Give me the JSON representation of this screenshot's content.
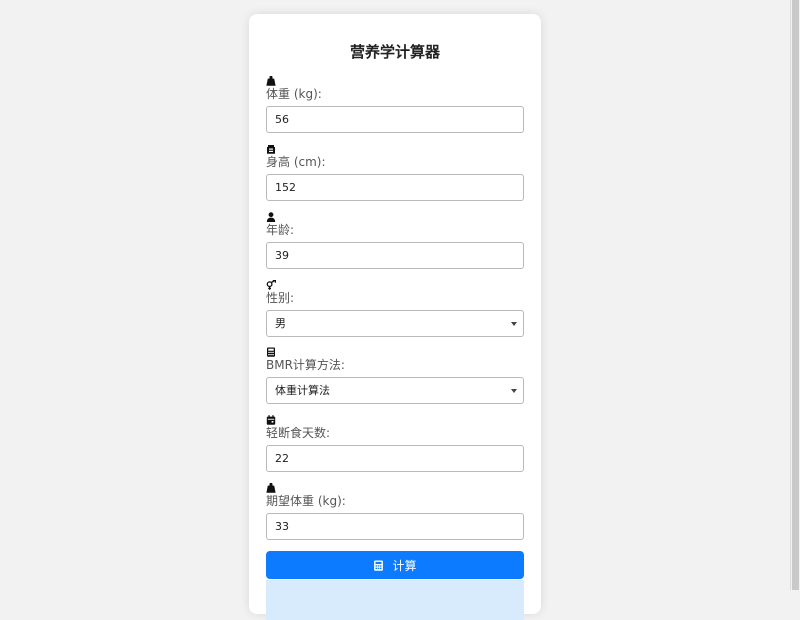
{
  "title": "营养学计算器",
  "fields": [
    {
      "icon": "weight-icon",
      "label": "体重 (kg):",
      "value": "56",
      "type": "input"
    },
    {
      "icon": "height-icon",
      "label": "身高 (cm):",
      "value": "152",
      "type": "input"
    },
    {
      "icon": "user-icon",
      "label": "年龄:",
      "value": "39",
      "type": "input"
    },
    {
      "icon": "gender-icon",
      "label": "性别:",
      "value": "男",
      "type": "select"
    },
    {
      "icon": "calculator-icon",
      "label": "BMR计算方法:",
      "value": "体重计算法",
      "type": "select"
    },
    {
      "icon": "calendar-icon",
      "label": "轻断食天数:",
      "value": "22",
      "type": "input"
    },
    {
      "icon": "weight-icon",
      "label": "期望体重 (kg):",
      "value": "33",
      "type": "input"
    }
  ],
  "button": {
    "icon": "calculator-icon",
    "label": "计算"
  },
  "colors": {
    "accent": "#0d7bff",
    "result_background": "#d7ebfc",
    "page_background": "#f2f2f2"
  }
}
